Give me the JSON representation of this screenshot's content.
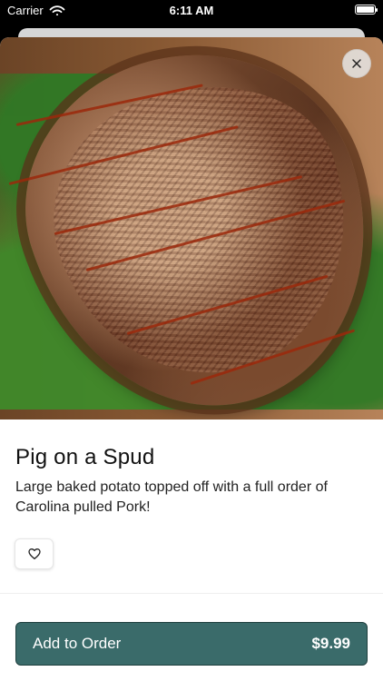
{
  "status_bar": {
    "carrier": "Carrier",
    "time": "6:11 AM"
  },
  "item": {
    "name": "Pig on a Spud",
    "description": "Large baked potato topped off with a full order of Carolina pulled Pork!",
    "price": "$9.99"
  },
  "actions": {
    "add_to_order_label": "Add to Order"
  },
  "icons": {
    "close": "close-icon",
    "favorite": "heart-outline-icon",
    "wifi": "wifi-icon",
    "battery": "battery-icon"
  },
  "colors": {
    "primary_button": "#3a6b6a",
    "button_text": "#ffffff"
  }
}
